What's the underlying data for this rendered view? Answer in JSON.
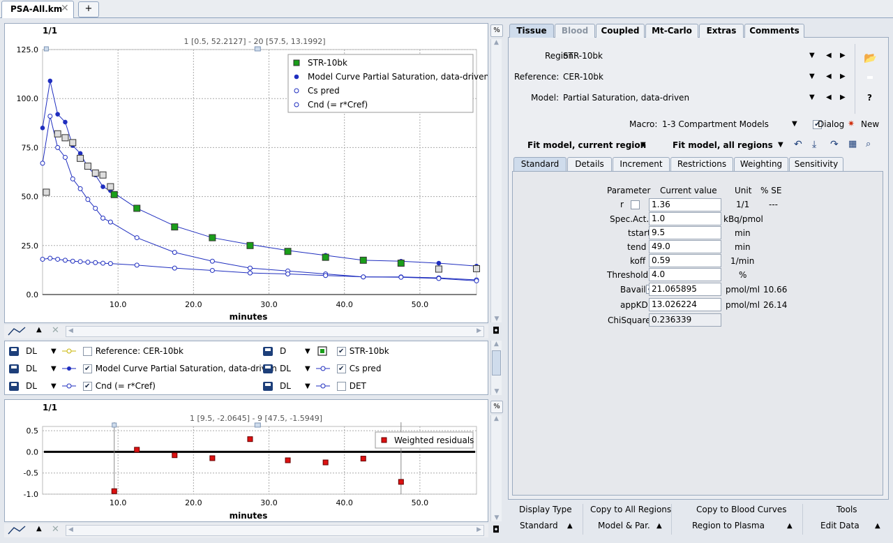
{
  "file_tab": {
    "title": "PSA-All.km",
    "close": "✕",
    "new_tab": "+"
  },
  "main_plot": {
    "scale": "1/1",
    "cursor_info": "1 [0.5, 52.2127] - 20 [57.5, 13.1992]",
    "percent_button": "%",
    "xlabel": "minutes",
    "legend": [
      "STR-10bk",
      "Model Curve Partial Saturation, data-driven",
      "Cs pred",
      "Cnd (= r*Cref)"
    ]
  },
  "chart_data": [
    {
      "type": "scatter",
      "title": "",
      "xlabel": "minutes",
      "ylabel": "",
      "xlim": [
        0,
        57.5
      ],
      "ylim": [
        0,
        125
      ],
      "x_ticks": [
        "10.0",
        "20.0",
        "30.0",
        "40.0",
        "50.0"
      ],
      "y_ticks": [
        "0.0",
        "25.0",
        "50.0",
        "75.0",
        "100.0",
        "125.0"
      ],
      "grid": true,
      "legend_position": "top-right",
      "series": [
        {
          "name": "STR-10bk",
          "color": "#1a9e1a",
          "x": [
            0.5,
            2,
            3,
            4,
            5,
            6,
            7,
            8,
            9,
            9.5,
            12.5,
            17.5,
            22.5,
            27.5,
            32.5,
            37.5,
            42.5,
            47.5,
            52.5,
            57.5
          ],
          "y": [
            52.2,
            82,
            80,
            77.5,
            69.5,
            65.5,
            62,
            61,
            55,
            51,
            44,
            34.5,
            29,
            25,
            22,
            19,
            17.5,
            16,
            13,
            13.2
          ]
        },
        {
          "name": "Model Curve Partial Saturation, data-driven",
          "color": "#1f2ebf",
          "x": [
            0,
            1,
            2,
            3,
            4,
            5,
            6,
            7,
            8,
            9,
            12.5,
            17.5,
            22.5,
            27.5,
            32.5,
            37.5,
            42.5,
            47.5,
            52.5,
            57.5
          ],
          "y": [
            85,
            109,
            92,
            88,
            76,
            72,
            65,
            61,
            55,
            53,
            44,
            35,
            29,
            25.5,
            22.5,
            20,
            17.5,
            17,
            16,
            14.5
          ]
        },
        {
          "name": "Cs pred",
          "color": "#1f2ebf",
          "x": [
            0,
            1,
            2,
            3,
            4,
            5,
            6,
            7,
            8,
            9,
            12.5,
            17.5,
            22.5,
            27.5,
            32.5,
            37.5,
            42.5,
            47.5,
            52.5,
            57.5
          ],
          "y": [
            67,
            91,
            75,
            70,
            59,
            54,
            48.5,
            44,
            39,
            37,
            29,
            21.5,
            17,
            13.5,
            12,
            10.5,
            9,
            9,
            8.5,
            7.5
          ]
        },
        {
          "name": "Cnd (= r*Cref)",
          "color": "#1f2ebf",
          "x": [
            0,
            1,
            2,
            3,
            4,
            5,
            6,
            7,
            8,
            9,
            12.5,
            17.5,
            22.5,
            27.5,
            32.5,
            37.5,
            42.5,
            47.5,
            52.5,
            57.5
          ],
          "y": [
            18,
            18.5,
            18,
            17.5,
            17,
            16.8,
            16.5,
            16.3,
            16,
            15.8,
            15,
            13.5,
            12.3,
            11,
            10.5,
            9.7,
            9,
            8.8,
            8.2,
            7
          ]
        }
      ]
    },
    {
      "type": "scatter",
      "title": "",
      "xlabel": "minutes",
      "ylabel": "",
      "xlim": [
        0,
        57.5
      ],
      "ylim": [
        -1.0,
        0.6
      ],
      "x_ticks": [
        "10.0",
        "20.0",
        "30.0",
        "40.0",
        "50.0"
      ],
      "y_ticks": [
        "0.5",
        "0.0",
        "-0.5",
        "-1.0"
      ],
      "grid": true,
      "legend_position": "top-right",
      "series": [
        {
          "name": "Weighted residuals",
          "color": "#dd1111",
          "x": [
            9.5,
            12.5,
            17.5,
            22.5,
            27.5,
            32.5,
            37.5,
            42.5,
            47.5
          ],
          "y": [
            -0.93,
            0.05,
            -0.08,
            -0.15,
            0.3,
            -0.2,
            -0.25,
            -0.16,
            -0.71
          ]
        }
      ]
    }
  ],
  "residual_plot": {
    "scale": "1/1",
    "cursor_info": "1 [9.5, -2.0645] - 9 [47.5, -1.5949]",
    "percent_button": "%",
    "xlabel": "minutes",
    "legend": "Weighted residuals"
  },
  "curve_list": [
    {
      "mode": "DL",
      "checked": false,
      "label": "Reference: CER-10bk"
    },
    {
      "mode": "D",
      "checked": true,
      "label": "STR-10bk"
    },
    {
      "mode": "DL",
      "checked": true,
      "label": "Model Curve Partial Saturation, data-driven"
    },
    {
      "mode": "DL",
      "checked": true,
      "label": "Cs pred"
    },
    {
      "mode": "DL",
      "checked": true,
      "label": "Cnd (= r*Cref)"
    },
    {
      "mode": "DL",
      "checked": false,
      "label": "DET"
    }
  ],
  "right_tabs": [
    "Tissue",
    "Blood",
    "Coupled",
    "Mt-Carlo",
    "Extras",
    "Comments"
  ],
  "selectors": {
    "region_label": "Region:",
    "region_value": "STR-10bk",
    "reference_label": "Reference:",
    "reference_value": "CER-10bk",
    "model_label": "Model:",
    "model_value": "Partial Saturation, data-driven",
    "macro_label": "Macro:",
    "macro_value": "1-3 Compartment Models",
    "dialog_label": "Dialog",
    "new_label": "New",
    "fit_current": "Fit model, current region",
    "fit_all": "Fit model, all regions"
  },
  "sub_tabs": [
    "Standard",
    "Details",
    "Increment",
    "Restrictions",
    "Weighting",
    "Sensitivity"
  ],
  "param_headers": {
    "parameter": "Parameter",
    "value": "Current value",
    "unit": "Unit",
    "se": "% SE"
  },
  "params": [
    {
      "name": "r",
      "value": "1.36",
      "unit": "1/1",
      "se": "---"
    },
    {
      "name": "Spec.Act.",
      "value": "1.0",
      "unit": "kBq/pmol",
      "se": ""
    },
    {
      "name": "tstart",
      "value": "9.5",
      "unit": "min",
      "se": ""
    },
    {
      "name": "tend",
      "value": "49.0",
      "unit": "min",
      "se": ""
    },
    {
      "name": "koff",
      "value": "0.59",
      "unit": "1/min",
      "se": ""
    },
    {
      "name": "Threshold",
      "value": "4.0",
      "unit": "%",
      "se": ""
    },
    {
      "name": "Bavail",
      "value": "21.065895",
      "unit": "pmol/ml",
      "se": "10.66"
    },
    {
      "name": "appKD",
      "value": "13.026224",
      "unit": "pmol/ml",
      "se": "26.14"
    },
    {
      "name": "ChiSquare",
      "value": "0.236339",
      "unit": "",
      "se": ""
    }
  ],
  "bottom": {
    "display_type": "Display Type",
    "display_value": "Standard",
    "copy_regions": "Copy to All Regions",
    "model_par": "Model & Par.",
    "copy_blood": "Copy to Blood Curves",
    "region_plasma": "Region to Plasma",
    "tools": "Tools",
    "edit_data": "Edit Data"
  }
}
